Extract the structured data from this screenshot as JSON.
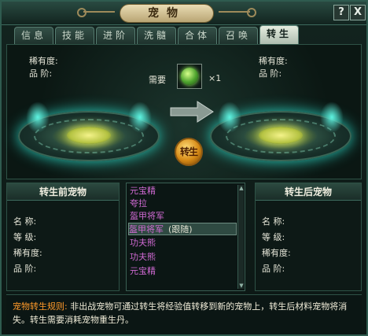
{
  "window": {
    "title": "宠物",
    "help_label": "?",
    "close_label": "X"
  },
  "tabs": [
    {
      "label": "信息",
      "active": false
    },
    {
      "label": "技能",
      "active": false
    },
    {
      "label": "进阶",
      "active": false
    },
    {
      "label": "洗髓",
      "active": false
    },
    {
      "label": "合体",
      "active": false
    },
    {
      "label": "召唤",
      "active": false
    },
    {
      "label": "转生",
      "active": true
    }
  ],
  "main": {
    "left_labels": {
      "rarity": "稀有度:",
      "rank": "品  阶:"
    },
    "right_labels": {
      "rarity": "稀有度:",
      "rank": "品  阶:"
    },
    "requirement_label": "需要",
    "requirement_count": "×1",
    "rebirth_button": "转生"
  },
  "before_panel": {
    "title": "转生前宠物",
    "labels": {
      "name": "名  称:",
      "level": "等  级:",
      "rarity": "稀有度:",
      "rank": "品  阶:"
    }
  },
  "after_panel": {
    "title": "转生后宠物",
    "labels": {
      "name": "名  称:",
      "level": "等  级:",
      "rarity": "稀有度:",
      "rank": "品  阶:"
    }
  },
  "pet_list": [
    {
      "name": "元宝精",
      "suffix": ""
    },
    {
      "name": "夸拉",
      "suffix": ""
    },
    {
      "name": "盔甲将军",
      "suffix": ""
    },
    {
      "name": "盔甲将军",
      "suffix": "(跟随)"
    },
    {
      "name": "功夫熊",
      "suffix": ""
    },
    {
      "name": "功夫熊",
      "suffix": ""
    },
    {
      "name": "元宝精",
      "suffix": ""
    }
  ],
  "rules": {
    "title": "宠物转生规则:",
    "text": " 非出战宠物可通过转生将经验值转移到新的宠物上，转生后材料宠物将消失。转生需要消耗宠物重生丹。"
  },
  "colors": {
    "accent": "#ff9a2a",
    "list_item": "#d06ad3"
  }
}
